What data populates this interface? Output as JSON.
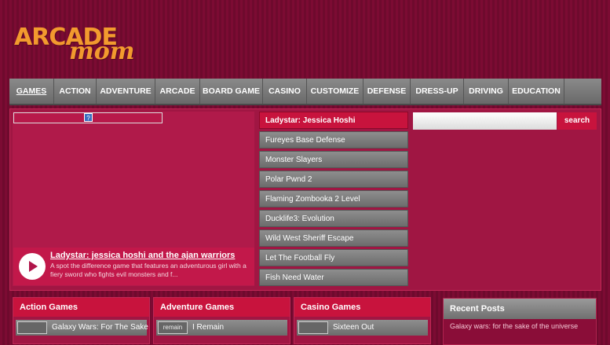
{
  "logo": {
    "part1": "ARCADE",
    "part2": "mom"
  },
  "nav": [
    "GAMES",
    "ACTION",
    "ADVENTURE",
    "ARCADE",
    "BOARD GAME",
    "CASINO",
    "CUSTOMIZE",
    "DEFENSE",
    "DRESS-UP",
    "DRIVING",
    "EDUCATION"
  ],
  "video": {
    "title": "Ladystar: jessica hoshi and the ajan warriors",
    "description": "A spot the difference game that features an adventurous girl with a fiery sword who fights evil monsters and f..."
  },
  "games": [
    "Ladystar: Jessica Hoshi",
    "Fureyes Base Defense",
    "Monster Slayers",
    "Polar Pwnd 2",
    "Flaming Zombooka 2 Level",
    "Ducklife3: Evolution",
    "Wild West Sheriff Escape",
    "Let The Football Fly",
    "Fish Need Water"
  ],
  "search": {
    "button": "search",
    "placeholder": ""
  },
  "sections": {
    "action": {
      "title": "Action Games",
      "entry": "Galaxy Wars: For The Sake"
    },
    "adventure": {
      "title": "Adventure Games",
      "entry": "I Remain",
      "thumb": "remain"
    },
    "casino": {
      "title": "Casino Games",
      "entry": "Sixteen Out"
    }
  },
  "recent": {
    "title": "Recent Posts",
    "item": "Galaxy wars: for the sake of the universe"
  },
  "colors": {
    "background": "#7c0b33",
    "accent": "#c8133d",
    "logo": "#f29a2e",
    "nav": "#7a7a7a"
  }
}
